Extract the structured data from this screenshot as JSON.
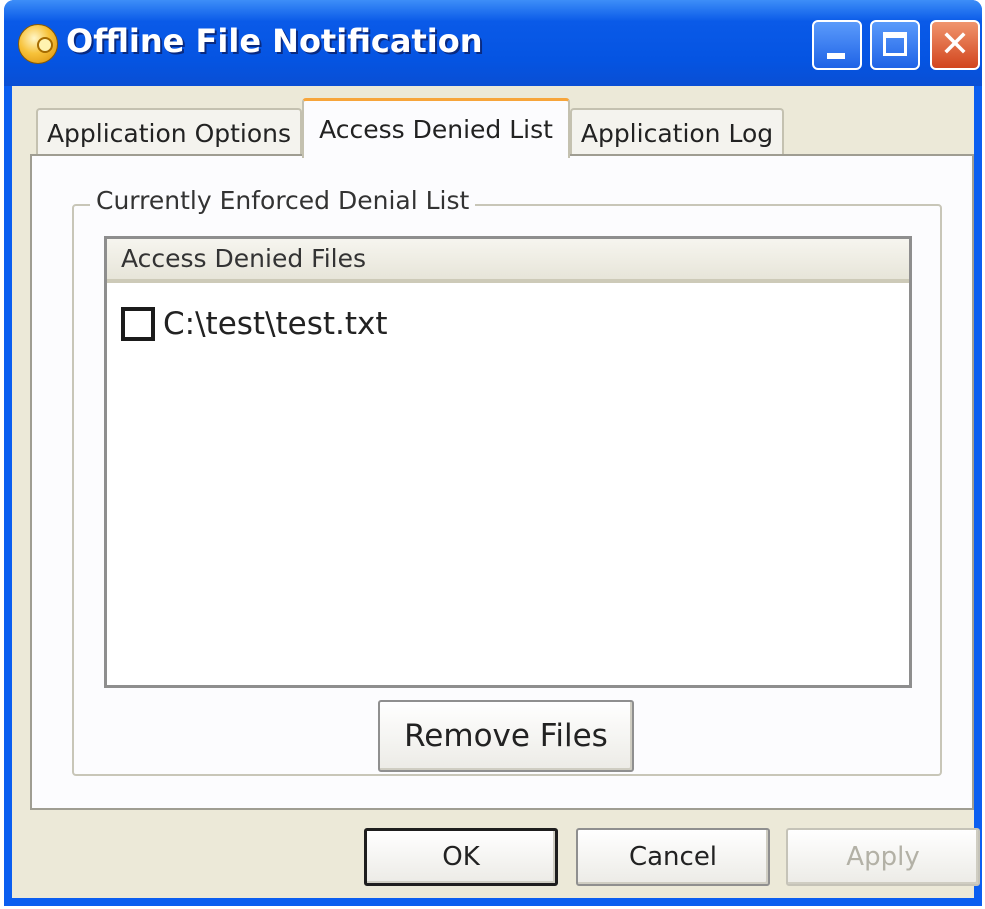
{
  "window": {
    "title": "Offline File  Notification",
    "icon": "offline-file-app-icon",
    "controls": [
      "minimize-icon",
      "maximize-icon",
      "close-icon"
    ]
  },
  "tabs": [
    {
      "label": "Application Options",
      "selected": false
    },
    {
      "label": "Access Denied List",
      "selected": true
    },
    {
      "label": "Application Log",
      "selected": false
    }
  ],
  "group": {
    "label": "Currently Enforced Denial List",
    "list": {
      "column_header": "Access Denied Files",
      "items": [
        {
          "label": "C:\\test\\test.txt",
          "checked": false
        }
      ]
    },
    "remove_button": "Remove Files"
  },
  "buttons": {
    "ok": "OK",
    "cancel": "Cancel",
    "apply": "Apply",
    "apply_enabled": false
  },
  "colors": {
    "titlebar": "#0554e2",
    "client_bg": "#ece9d8",
    "selected_tab_accent": "#f7a53b",
    "close_button": "#d2451d"
  }
}
